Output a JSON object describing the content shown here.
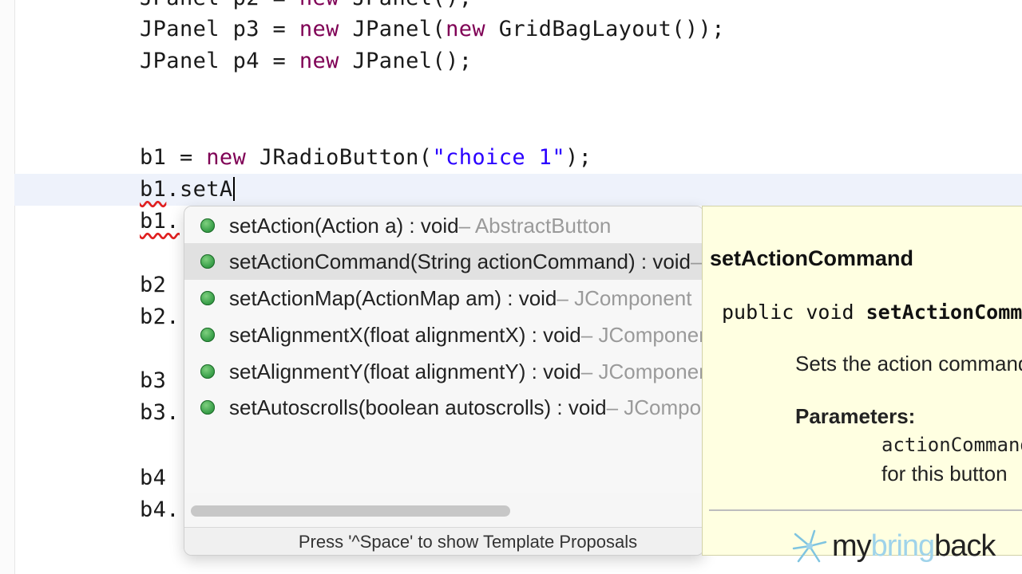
{
  "editor": {
    "lines": {
      "l0": {
        "a": "JPanel p2 = ",
        "kw": "new",
        "b": " JPanel();"
      },
      "l1": {
        "a": "JPanel p3 = ",
        "kw1": "new",
        "b": " JPanel(",
        "kw2": "new",
        "c": " GridBagLayout());"
      },
      "l2": {
        "a": "JPanel p4 = ",
        "kw": "new",
        "b": " JPanel();"
      },
      "l3": {
        "a": "b1 = ",
        "kw": "new",
        "b": " JRadioButton(",
        "str": "\"choice 1\"",
        "c": ");"
      },
      "l4": {
        "err": "b1",
        "rest": ".setA"
      },
      "l5": {
        "err": "b1."
      },
      "l6": {
        "text": "b2"
      },
      "l7": {
        "text": "b2."
      },
      "l8": {
        "text": "b3"
      },
      "l9": {
        "text": "b3."
      },
      "l10": {
        "text": "b4"
      },
      "l11": {
        "text": "b4."
      }
    }
  },
  "autocomplete": {
    "proposals": [
      {
        "name": "setAction(Action a) : void",
        "owner": " – AbstractButton"
      },
      {
        "name": "setActionCommand(String actionCommand) : void",
        "owner": " – AbstractButton"
      },
      {
        "name": "setActionMap(ActionMap am) : void",
        "owner": " – JComponent"
      },
      {
        "name": "setAlignmentX(float alignmentX) : void",
        "owner": " – JComponent"
      },
      {
        "name": "setAlignmentY(float alignmentY) : void",
        "owner": " – JComponent"
      },
      {
        "name": "setAutoscrolls(boolean autoscrolls) : void",
        "owner": " – JComponent"
      }
    ],
    "selected_index": 1,
    "hint": "Press '^Space' to show Template Proposals"
  },
  "javadoc": {
    "title": "setActionCommand",
    "signature_prefix": "public void ",
    "signature_method": "setActionCommand(String actionCommand)",
    "description": "Sets the action command for this button.",
    "params_label": "Parameters:",
    "param_name": "actionCommand",
    "param_desc": "for this button"
  },
  "watermark": {
    "word1": "my",
    "word2": "bring",
    "word3": "back",
    "colors": {
      "dark": "#222222",
      "light": "#9fd3ea"
    }
  },
  "colors": {
    "keyword": "#7f0055",
    "string": "#2a00ff",
    "current_line": "#eef2fb",
    "doc_background": "#ffffe1",
    "proposal_icon": "#3aa04a"
  }
}
